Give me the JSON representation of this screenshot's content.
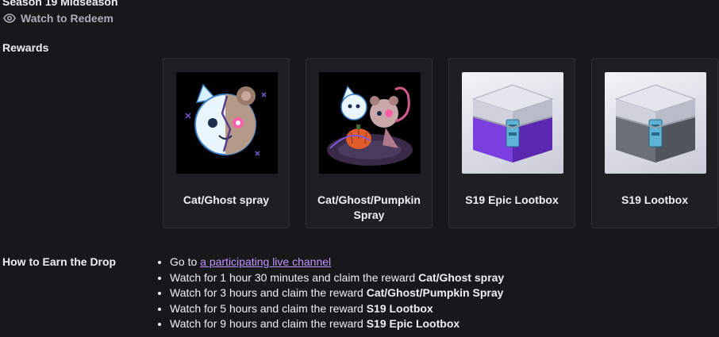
{
  "campaign": {
    "title": "Season 19 Midseason",
    "watch_label": "Watch to Redeem",
    "eye_icon": "eye-icon"
  },
  "rewards": {
    "label": "Rewards",
    "items": [
      {
        "name": "Cat/Ghost spray",
        "icon": "cat-ghost-spray-image"
      },
      {
        "name": "Cat/Ghost/Pumpkin Spray",
        "icon": "cat-ghost-pumpkin-spray-image"
      },
      {
        "name": "S19 Epic Lootbox",
        "icon": "epic-lootbox-image",
        "accent": "#7b3fe0"
      },
      {
        "name": "S19 Lootbox",
        "icon": "lootbox-image",
        "accent": "#5a5f66"
      }
    ]
  },
  "earn": {
    "label": "How to Earn the Drop",
    "steps": [
      {
        "prefix": "Go to ",
        "link": "a participating live channel"
      },
      {
        "prefix": "Watch for 1 hour 30 minutes and claim the reward ",
        "reward": "Cat/Ghost spray"
      },
      {
        "prefix": "Watch for 3 hours and claim the reward ",
        "reward": "Cat/Ghost/Pumpkin Spray"
      },
      {
        "prefix": "Watch for 5 hours and claim the reward ",
        "reward": "S19 Lootbox"
      },
      {
        "prefix": "Watch for 9 hours and claim the reward ",
        "reward": "S19 Epic Lootbox"
      }
    ]
  },
  "colors": {
    "background": "#18181b",
    "card": "#1f1f23",
    "link": "#bf94ff",
    "muted": "#adadb8"
  }
}
